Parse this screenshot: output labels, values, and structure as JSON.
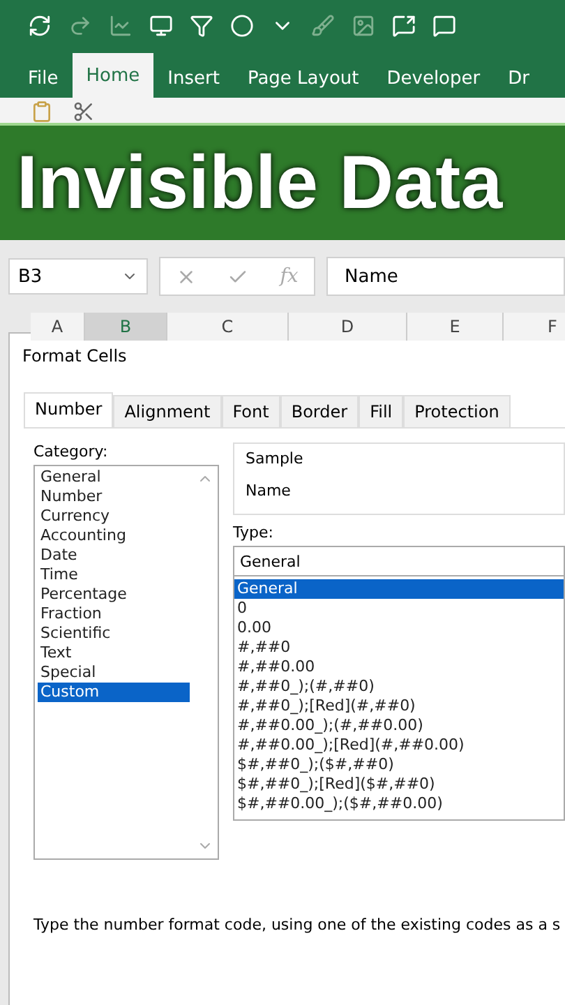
{
  "ribbon": {
    "tabs": [
      {
        "label": "File",
        "selected": false
      },
      {
        "label": "Home",
        "selected": true
      },
      {
        "label": "Insert",
        "selected": false
      },
      {
        "label": "Page Layout",
        "selected": false
      },
      {
        "label": "Developer",
        "selected": false
      },
      {
        "label": "Dr",
        "selected": false
      }
    ]
  },
  "banner": {
    "title": "Invisible Data"
  },
  "formula_bar": {
    "name_box": "B3",
    "formula": "Name",
    "function_label": "fx"
  },
  "columns": [
    {
      "label": "A",
      "selected": false
    },
    {
      "label": "B",
      "selected": true
    },
    {
      "label": "C",
      "selected": false
    },
    {
      "label": "D",
      "selected": false
    },
    {
      "label": "E",
      "selected": false
    },
    {
      "label": "F",
      "selected": false
    }
  ],
  "dialog": {
    "title": "Format Cells",
    "tabs": [
      {
        "label": "Number",
        "selected": true
      },
      {
        "label": "Alignment",
        "selected": false
      },
      {
        "label": "Font",
        "selected": false
      },
      {
        "label": "Border",
        "selected": false
      },
      {
        "label": "Fill",
        "selected": false
      },
      {
        "label": "Protection",
        "selected": false
      }
    ],
    "category_label": "Category:",
    "categories": [
      {
        "label": "General",
        "selected": false
      },
      {
        "label": "Number",
        "selected": false
      },
      {
        "label": "Currency",
        "selected": false
      },
      {
        "label": "Accounting",
        "selected": false
      },
      {
        "label": "Date",
        "selected": false
      },
      {
        "label": "Time",
        "selected": false
      },
      {
        "label": "Percentage",
        "selected": false
      },
      {
        "label": "Fraction",
        "selected": false
      },
      {
        "label": "Scientific",
        "selected": false
      },
      {
        "label": "Text",
        "selected": false
      },
      {
        "label": "Special",
        "selected": false
      },
      {
        "label": "Custom",
        "selected": true
      }
    ],
    "sample_label": "Sample",
    "sample_value": "Name",
    "type_label": "Type:",
    "type_value": "General",
    "types": [
      {
        "label": "General",
        "selected": true
      },
      {
        "label": "0",
        "selected": false
      },
      {
        "label": "0.00",
        "selected": false
      },
      {
        "label": "#,##0",
        "selected": false
      },
      {
        "label": "#,##0.00",
        "selected": false
      },
      {
        "label": "#,##0_);(#,##0)",
        "selected": false
      },
      {
        "label": "#,##0_);[Red](#,##0)",
        "selected": false
      },
      {
        "label": "#,##0.00_);(#,##0.00)",
        "selected": false
      },
      {
        "label": "#,##0.00_);[Red](#,##0.00)",
        "selected": false
      },
      {
        "label": "$#,##0_);($#,##0)",
        "selected": false
      },
      {
        "label": "$#,##0_);[Red]($#,##0)",
        "selected": false
      },
      {
        "label": "$#,##0.00_);($#,##0.00)",
        "selected": false
      }
    ],
    "description": "Type the number format code, using one of the existing codes as a s"
  }
}
